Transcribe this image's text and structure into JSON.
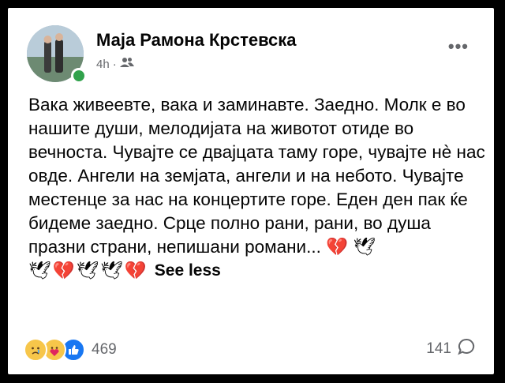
{
  "post": {
    "author": "Маја Рамона Крстевска",
    "time": "4h",
    "separator": "·",
    "audience_icon": "friends-icon",
    "text": "Вака живеевте, вака и заминавте. Заедно. Молк е во нашите души, мелодијата на животот отиде во вечноста. Чувајте се двајцата таму горе, чувајте нè нас овде. Ангели на земјата, ангели и на небото. Чувајте местенце за нас на концертите горе. Еден ден пак ќе бидеме заедно. Срце полно рани, рани, во душа празни страни, непишани романи...",
    "see_less": "See less",
    "emojis": [
      "broken-heart",
      "dove",
      "dove",
      "broken-heart",
      "dove",
      "dove",
      "broken-heart"
    ]
  },
  "footer": {
    "reactions": [
      "sad-face",
      "care-face",
      "like"
    ],
    "reaction_count": "469",
    "comment_count": "141",
    "comment_icon": "comment-bubble-icon"
  },
  "colors": {
    "meta": "#65676b",
    "online": "#31a24c",
    "like": "#1877f2",
    "heart": "#e0245e"
  }
}
